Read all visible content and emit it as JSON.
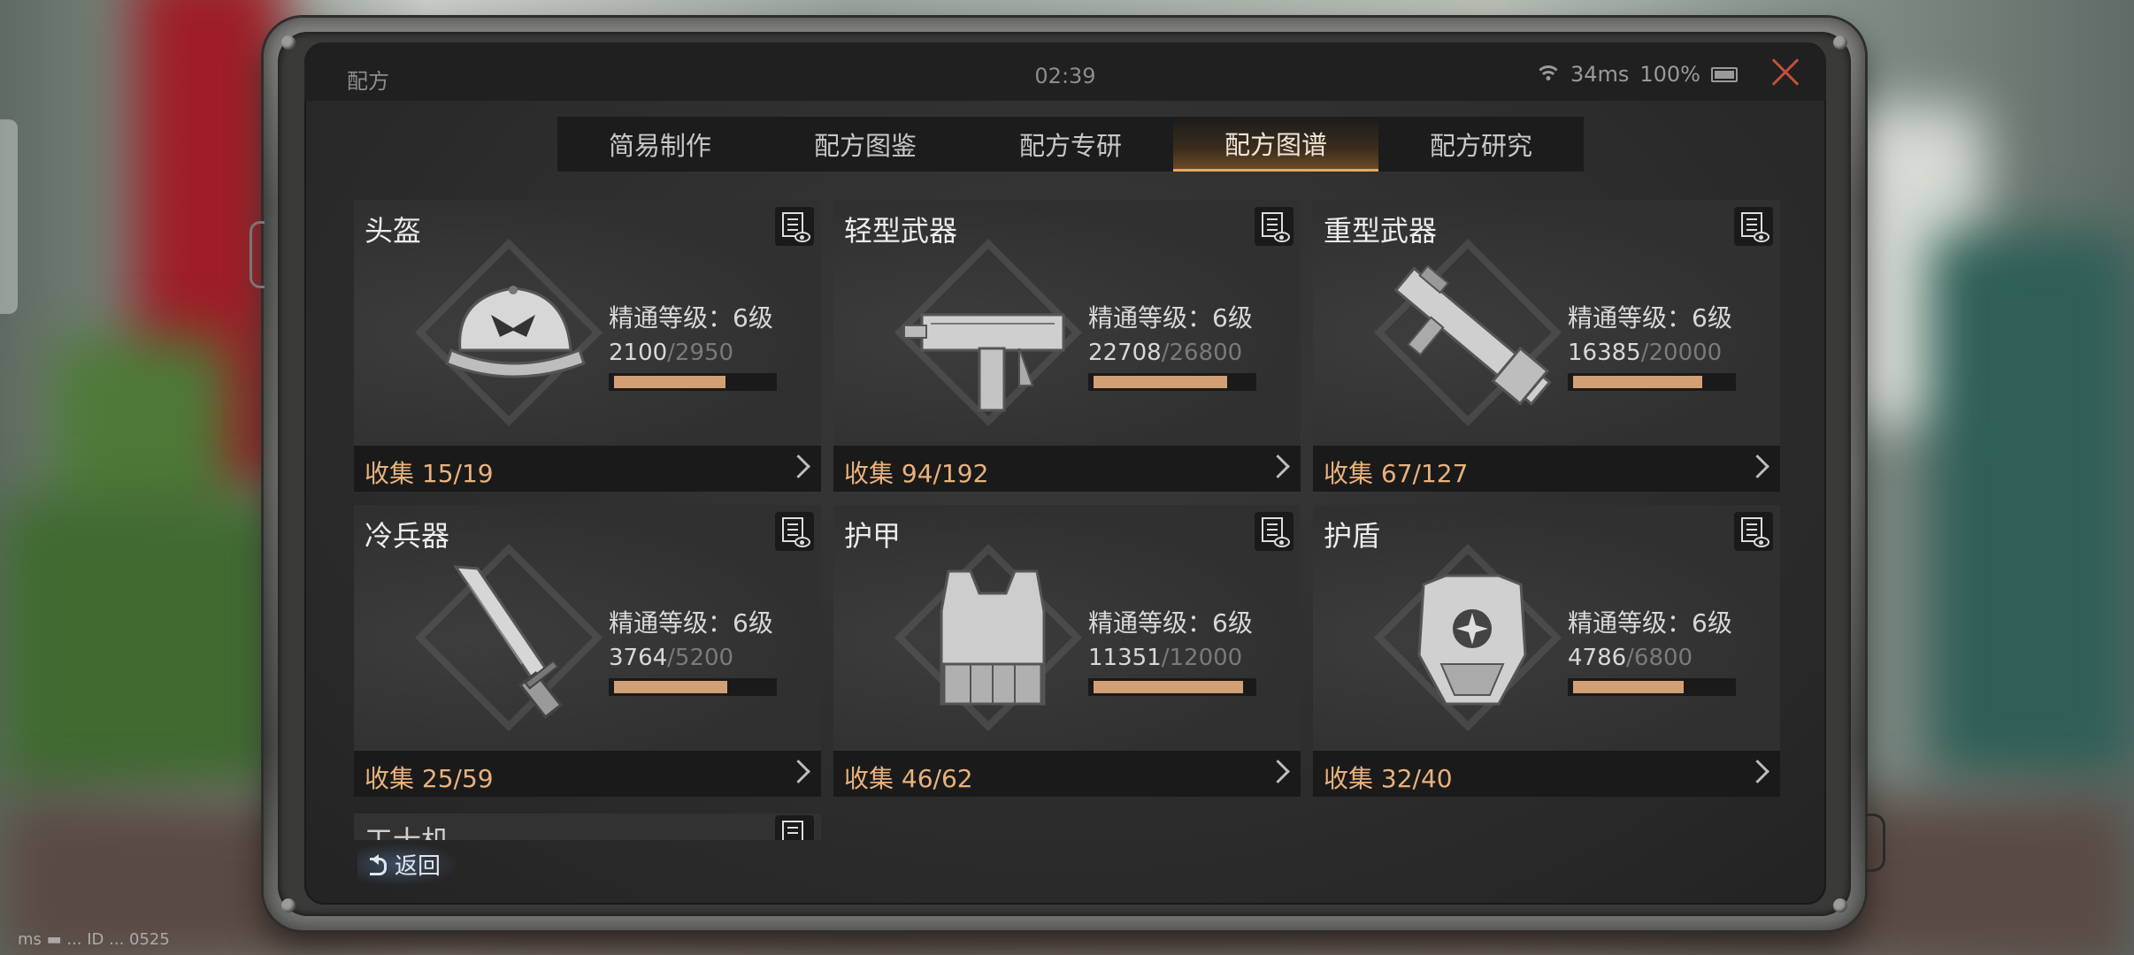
{
  "window": {
    "title": "配方",
    "time": "02:39",
    "ping": "34ms",
    "battery": "100%"
  },
  "tabs": [
    {
      "label": "简易制作",
      "active": false
    },
    {
      "label": "配方图鉴",
      "active": false
    },
    {
      "label": "配方专研",
      "active": false
    },
    {
      "label": "配方图谱",
      "active": true
    },
    {
      "label": "配方研究",
      "active": false
    }
  ],
  "cards": [
    {
      "title": "头盔",
      "icon": "helmet-cap-icon",
      "mastery": "精通等级：6级",
      "exp_current": "2100",
      "exp_max": "/2950",
      "progress": 0.71,
      "collect": "收集 15/19"
    },
    {
      "title": "轻型武器",
      "icon": "submachine-gun-icon",
      "mastery": "精通等级：6级",
      "exp_current": "22708",
      "exp_max": "/26800",
      "progress": 0.85,
      "collect": "收集 94/192"
    },
    {
      "title": "重型武器",
      "icon": "rocket-launcher-icon",
      "mastery": "精通等级：6级",
      "exp_current": "16385",
      "exp_max": "/20000",
      "progress": 0.82,
      "collect": "收集 67/127"
    },
    {
      "title": "冷兵器",
      "icon": "machete-icon",
      "mastery": "精通等级：6级",
      "exp_current": "3764",
      "exp_max": "/5200",
      "progress": 0.72,
      "collect": "收集 25/59"
    },
    {
      "title": "护甲",
      "icon": "body-armor-vest-icon",
      "mastery": "精通等级：6级",
      "exp_current": "11351",
      "exp_max": "/12000",
      "progress": 0.95,
      "collect": "收集 46/62"
    },
    {
      "title": "护盾",
      "icon": "chest-shield-icon",
      "mastery": "精通等级：6级",
      "exp_current": "4786",
      "exp_max": "/6800",
      "progress": 0.7,
      "collect": "收集 32/40"
    }
  ],
  "partial_card": {
    "title": "工士机"
  },
  "back": {
    "label": "返回"
  },
  "debug": {
    "text": "ms ▬ ... ID ... 0525"
  },
  "colors": {
    "accent": "#e9b27d",
    "bar_fill": "#d2a074",
    "close": "#c0503c"
  }
}
